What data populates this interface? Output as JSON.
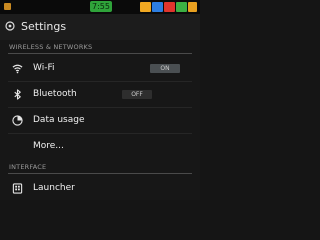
{
  "status_bar": {
    "clock": "7:55",
    "colors": {
      "left_icon": "#c98a22",
      "clock_bg": "#2fa33a",
      "icons": [
        "#f0a822",
        "#2d7ee0",
        "#e0352d",
        "#3cb043",
        "#e8a020"
      ]
    }
  },
  "action_bar": {
    "title": "Settings",
    "icon": "settings-icon"
  },
  "sections": {
    "wireless": {
      "title": "WIRELESS & NETWORKS"
    },
    "interface": {
      "title": "INTERFACE"
    }
  },
  "items": {
    "wifi": {
      "label": "Wi-Fi",
      "icon": "wifi-icon",
      "toggle": "ON"
    },
    "bluetooth": {
      "label": "Bluetooth",
      "icon": "bluetooth-icon",
      "toggle": "OFF"
    },
    "data_usage": {
      "label": "Data usage",
      "icon": "data-usage-icon"
    },
    "more": {
      "label": "More..."
    },
    "launcher": {
      "label": "Launcher",
      "icon": "launcher-icon"
    }
  },
  "colors": {
    "background": "#171717",
    "toggle_on": "#4a4f52",
    "toggle_off": "#2e2e2e",
    "header_text": "#9a9a9a"
  }
}
